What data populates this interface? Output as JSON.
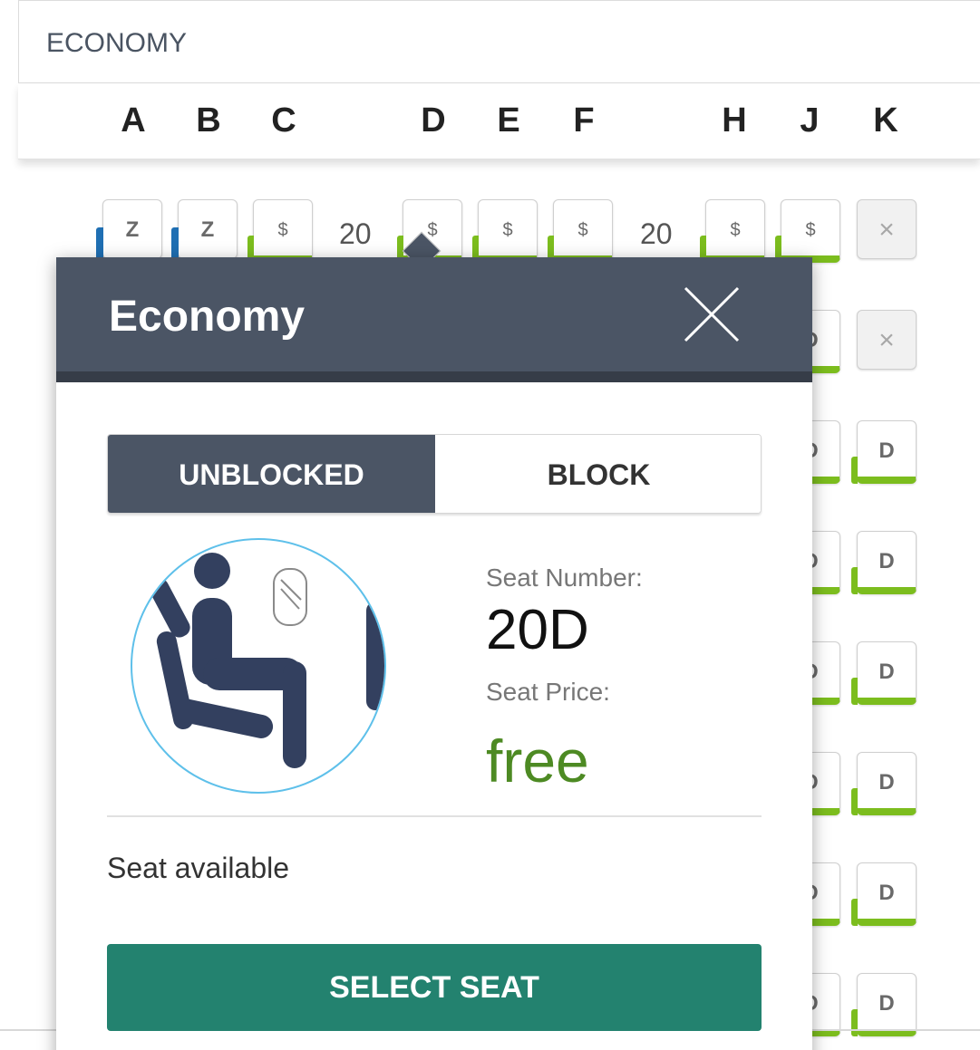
{
  "section": {
    "title": "ECONOMY"
  },
  "columns": [
    "A",
    "B",
    "C",
    "D",
    "E",
    "F",
    "H",
    "J",
    "K"
  ],
  "seat_rows": [
    {
      "row_number": "20",
      "seats": [
        {
          "label": "Z"
        },
        {
          "label": "Z"
        },
        {
          "label": "$"
        },
        {
          "label": "$"
        },
        {
          "label": "$"
        },
        {
          "label": "$"
        },
        {
          "label": "$"
        },
        {
          "label": "$"
        },
        {
          "label": "×"
        }
      ]
    },
    {
      "seats": [
        {
          "label": "D"
        },
        {
          "label": "×"
        }
      ]
    },
    {
      "seats": [
        {
          "label": "D"
        },
        {
          "label": "D"
        }
      ]
    },
    {
      "seats": [
        {
          "label": "D"
        },
        {
          "label": "D"
        }
      ]
    },
    {
      "seats": [
        {
          "label": "D"
        },
        {
          "label": "D"
        }
      ]
    },
    {
      "seats": [
        {
          "label": "D"
        },
        {
          "label": "D"
        }
      ]
    },
    {
      "seats": [
        {
          "label": "D"
        },
        {
          "label": "D"
        }
      ]
    },
    {
      "seats": [
        {
          "label": "D"
        },
        {
          "label": "D"
        }
      ]
    }
  ],
  "popup": {
    "title": "Economy",
    "close_icon": "close-icon",
    "toggle": {
      "active": "UNBLOCKED",
      "inactive": "BLOCK"
    },
    "illustration_icon": "seated-passenger-icon",
    "seat_number_label": "Seat Number:",
    "seat_number": "20D",
    "seat_price_label": "Seat Price:",
    "seat_price": "free",
    "status": "Seat available",
    "select_label": "SELECT SEAT"
  },
  "colors": {
    "header_bg": "#4b5565",
    "header_border": "#363d48",
    "select_button": "#23826f",
    "price_green": "#4d8a23",
    "seat_green": "#7cbd1e",
    "seat_blue": "#1f6fb3"
  }
}
